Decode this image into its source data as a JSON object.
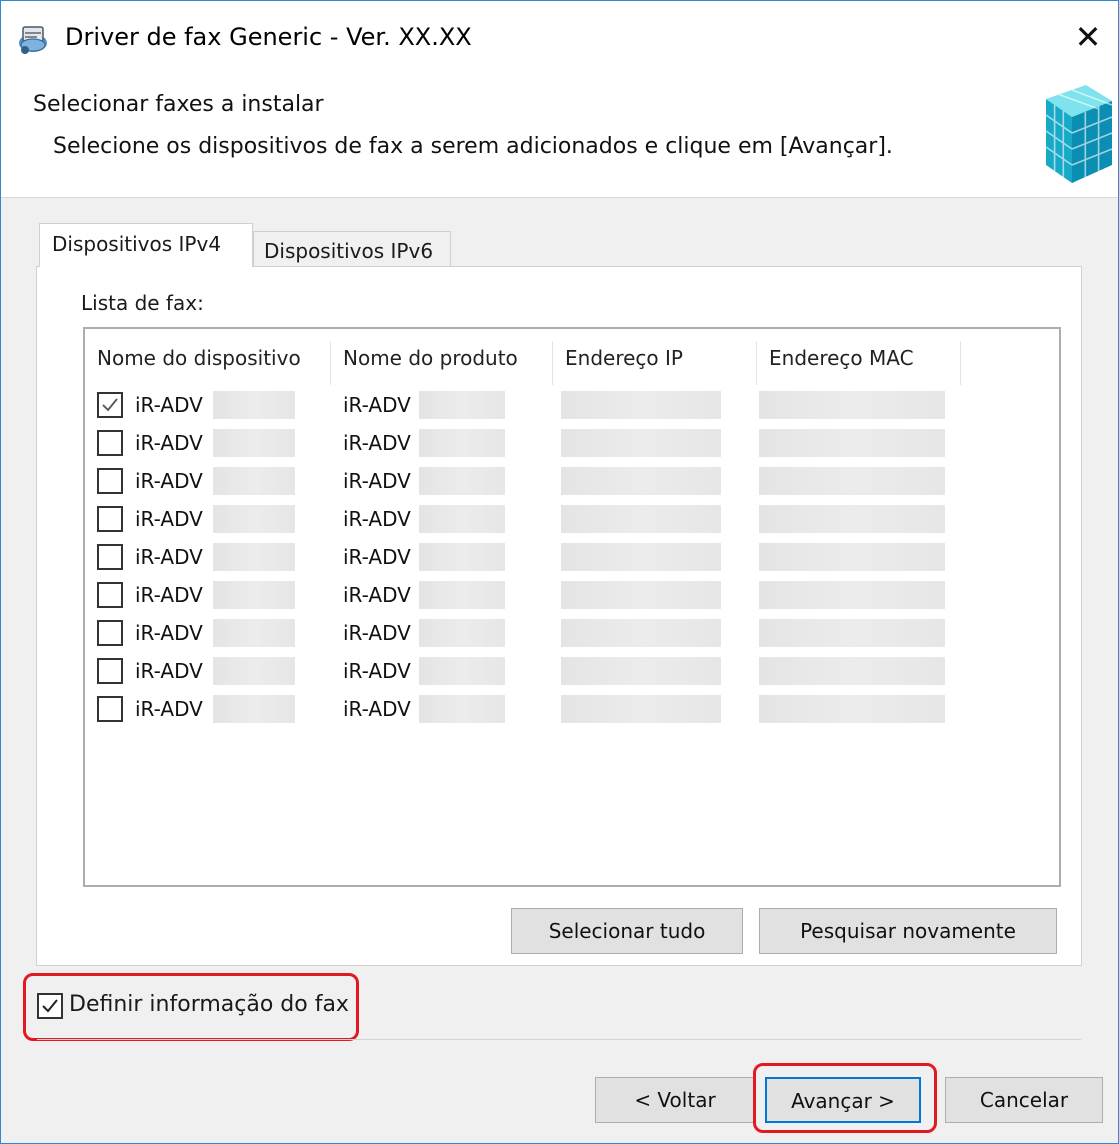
{
  "window": {
    "title": "Driver de fax Generic - Ver.  XX.XX",
    "close_glyph": "✕"
  },
  "header": {
    "title": "Selecionar faxes a instalar",
    "subtitle": "Selecione os dispositivos de fax a serem adicionados e clique em [Avançar]."
  },
  "tabs": [
    {
      "label": "Dispositivos IPv4",
      "active": true
    },
    {
      "label": "Dispositivos IPv6",
      "active": false
    }
  ],
  "fax_list": {
    "label": "Lista de fax:",
    "columns": [
      "Nome do dispositivo",
      "Nome do produto",
      "Endereço IP",
      "Endereço MAC"
    ],
    "rows": [
      {
        "checked": true,
        "device": "iR-ADV",
        "product": "iR-ADV"
      },
      {
        "checked": false,
        "device": "iR-ADV",
        "product": "iR-ADV"
      },
      {
        "checked": false,
        "device": "iR-ADV",
        "product": "iR-ADV"
      },
      {
        "checked": false,
        "device": "iR-ADV",
        "product": "iR-ADV"
      },
      {
        "checked": false,
        "device": "iR-ADV",
        "product": "iR-ADV"
      },
      {
        "checked": false,
        "device": "iR-ADV",
        "product": "iR-ADV"
      },
      {
        "checked": false,
        "device": "iR-ADV",
        "product": "iR-ADV"
      },
      {
        "checked": false,
        "device": "iR-ADV",
        "product": "iR-ADV"
      },
      {
        "checked": false,
        "device": "iR-ADV",
        "product": "iR-ADV"
      }
    ]
  },
  "buttons": {
    "select_all": "Selecionar tudo",
    "search_again": "Pesquisar novamente",
    "back": "< Voltar",
    "next": "Avançar >",
    "cancel": "Cancelar"
  },
  "fax_info": {
    "label": "Definir informação do fax",
    "checked": true
  },
  "colors": {
    "highlight": "#e11a22",
    "accent": "#0078d7",
    "window_border": "#2a8bd0"
  },
  "icons": {
    "app": "printer-fax-icon",
    "header_graphic": "cube-blocks-icon",
    "close": "close-icon",
    "checkmark": "checkmark-icon"
  }
}
